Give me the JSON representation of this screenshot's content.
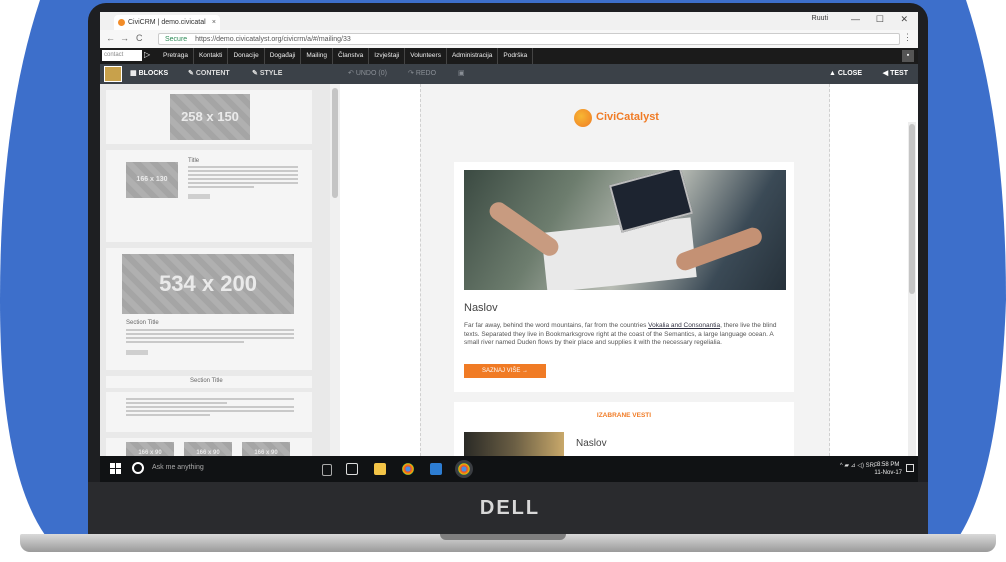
{
  "browser": {
    "tab_title": "CiviCRM | demo.civicatal",
    "tab_close": "×",
    "user": "Ruuti",
    "window_buttons": [
      "—",
      "☐",
      "✕"
    ],
    "nav": [
      "←",
      "→",
      "C"
    ],
    "secure_label": "Secure",
    "url": "https://demo.civicatalyst.org/civicrm/a/#/mailing/33",
    "menu": "⋮"
  },
  "civicrm_menu": {
    "search_placeholder": "contact",
    "home": "▷",
    "items": [
      "Pretraga",
      "Kontakti",
      "Donacije",
      "Događaji",
      "Mailing",
      "Članstva",
      "Izvještaji",
      "Volunteers",
      "Administracija",
      "Podrška"
    ],
    "collapse": "▪"
  },
  "mosaico": {
    "tabs": [
      {
        "label": "BLOCKS",
        "icon": "blocks-icon"
      },
      {
        "label": "CONTENT",
        "icon": "pencil-icon"
      },
      {
        "label": "STYLE",
        "icon": "brush-icon"
      }
    ],
    "undo": "UNDO (0)",
    "redo": "REDO",
    "close": "CLOSE",
    "test": "TEST"
  },
  "blocks": {
    "ph1": "258 x 150",
    "ph2": "166 x 130",
    "ph3": "534 x 200",
    "section_title": "Section Title",
    "title": "Title",
    "ph4": "166 x 90"
  },
  "email": {
    "logo_text": "CiviCatalyst",
    "card_title": "Naslov",
    "card_body_1": "Far far away, behind the word mountains, far from the countries ",
    "card_body_link": "Vokalia and Consonantia",
    "card_body_2": ", there live the blind texts. Separated they live in Bookmarksgrove right at the coast of the Semantics, a large language ocean. A small river named Duden flows by their place and supplies it with the necessary regelialia.",
    "cta": "SAZNAJ VIŠE →",
    "section_head": "IZABRANE VESTI",
    "card2_title": "Naslov"
  },
  "taskbar": {
    "search": "Ask me anything",
    "tray": "^ ▰ ⊿ ◁) SRP",
    "time": "3:58 PM",
    "date": "11-Nov-17"
  },
  "device": {
    "brand": "DELL"
  },
  "colors": {
    "background_blob": "#3d6fcb",
    "accent": "#f07b25",
    "toolbar": "#3b4148"
  }
}
